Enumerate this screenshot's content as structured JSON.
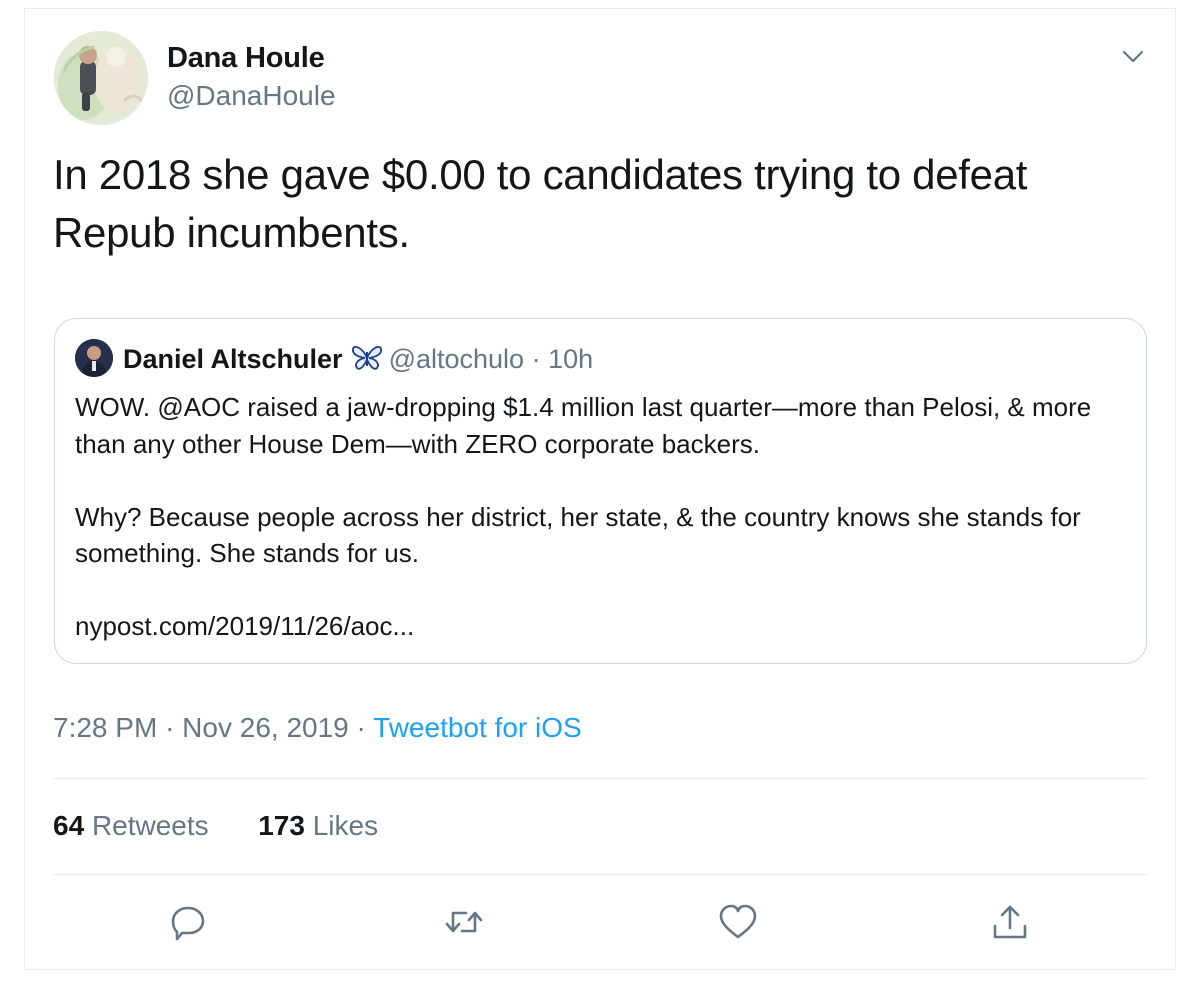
{
  "author": {
    "name": "Dana Houle",
    "handle": "@DanaHoule"
  },
  "tweet": {
    "text": "In 2018 she gave $0.00 to candidates trying to defeat Repub incumbents."
  },
  "quoted_tweet": {
    "author_name": "Daniel Altschuler",
    "author_emoji": "butterfly-icon",
    "handle": "@altochulo",
    "separator": "·",
    "age": "10h",
    "paragraphs": [
      "WOW. @AOC raised a jaw-dropping $1.4 million last quarter—more than Pelosi, & more than any other House Dem—with ZERO corporate backers.",
      "Why? Because people across her district, her state, & the country knows she stands for something. She stands for us.",
      "nypost.com/2019/11/26/aoc..."
    ]
  },
  "meta": {
    "time": "7:28 PM",
    "separator": "·",
    "date": "Nov 26, 2019",
    "source": "Tweetbot for iOS"
  },
  "stats": {
    "retweets_count": "64",
    "retweets_label": "Retweets",
    "likes_count": "173",
    "likes_label": "Likes"
  },
  "actions": [
    "reply-icon",
    "retweet-icon",
    "like-icon",
    "share-icon"
  ],
  "colors": {
    "text": "#14171a",
    "secondary": "#657786",
    "accent": "#1da1f2",
    "border": "#e6ecf0",
    "quote_border": "#ccd6dd"
  }
}
